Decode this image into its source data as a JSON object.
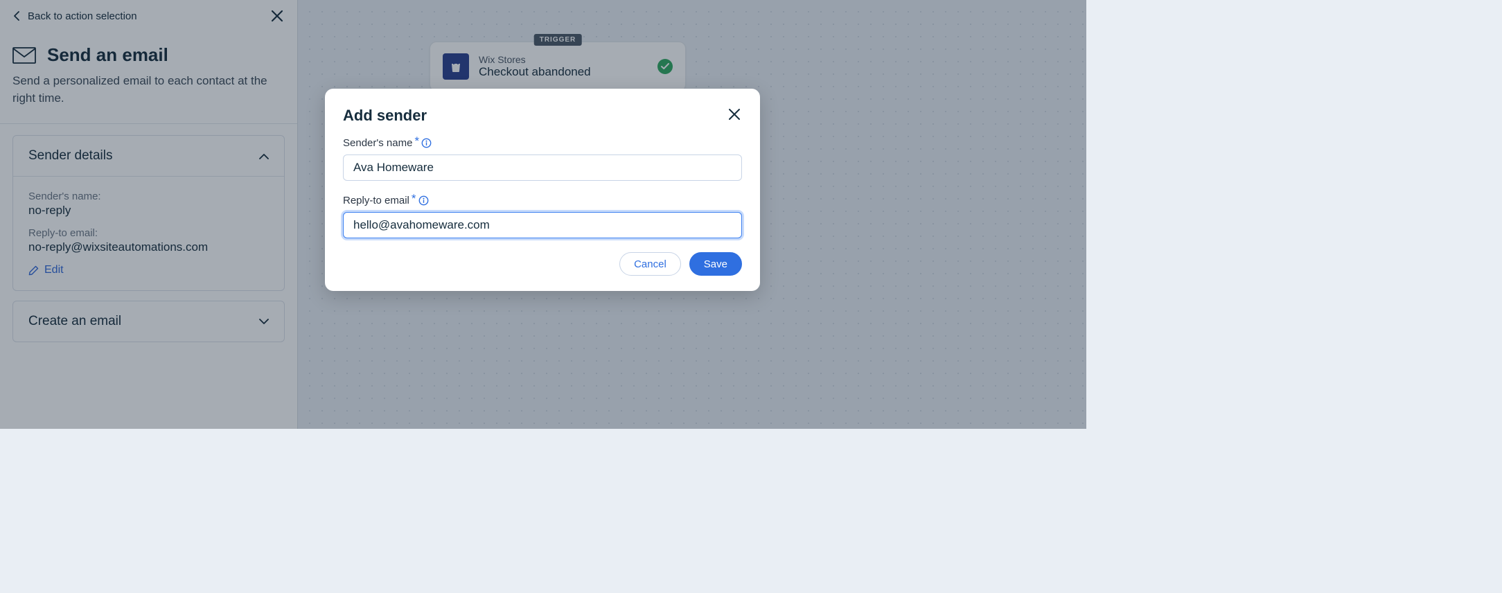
{
  "panel": {
    "back_label": "Back to action selection",
    "title": "Send an email",
    "description": "Send a personalized email to each contact at the right time.",
    "sender_section_title": "Sender details",
    "sender_name_label": "Sender's name:",
    "sender_name_value": "no-reply",
    "reply_to_label": "Reply-to email:",
    "reply_to_value": "no-reply@wixsiteautomations.com",
    "edit_label": "Edit",
    "create_section_title": "Create an email"
  },
  "canvas": {
    "trigger_tag": "TRIGGER",
    "trigger_source": "Wix Stores",
    "trigger_name": "Checkout abandoned"
  },
  "modal": {
    "title": "Add sender",
    "sender_name_label": "Sender's name",
    "sender_name_value": "Ava Homeware",
    "reply_email_label": "Reply-to email",
    "reply_email_value": "hello@avahomeware.com",
    "cancel_label": "Cancel",
    "save_label": "Save"
  }
}
